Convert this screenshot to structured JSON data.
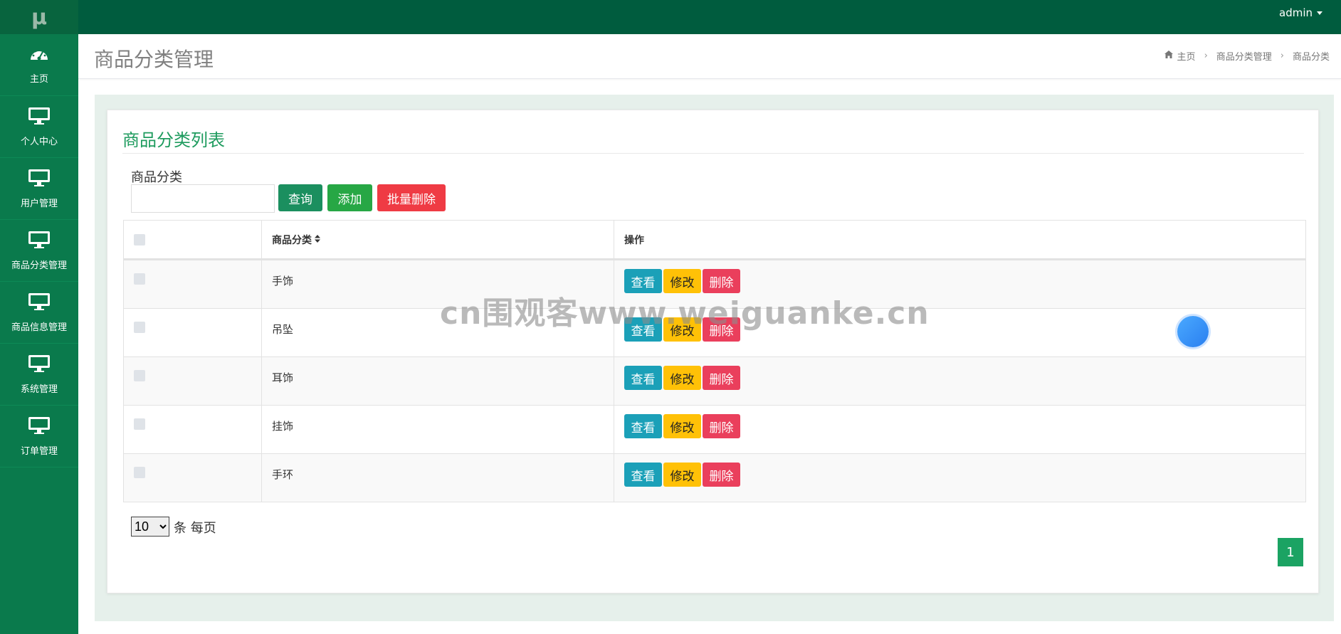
{
  "sidebar": {
    "logo": "μ",
    "items": [
      {
        "label": "主页",
        "icon": "dashboard-icon"
      },
      {
        "label": "个人中心",
        "icon": "monitor-icon"
      },
      {
        "label": "用户管理",
        "icon": "monitor-icon"
      },
      {
        "label": "商品分类管理",
        "icon": "monitor-icon"
      },
      {
        "label": "商品信息管理",
        "icon": "monitor-icon"
      },
      {
        "label": "系统管理",
        "icon": "monitor-icon"
      },
      {
        "label": "订单管理",
        "icon": "monitor-icon"
      }
    ]
  },
  "topbar": {
    "user": "admin"
  },
  "header": {
    "title": "商品分类管理",
    "breadcrumb": [
      "主页",
      "商品分类管理",
      "商品分类"
    ]
  },
  "panel": {
    "title": "商品分类列表",
    "search_label": "商品分类",
    "search_value": "",
    "buttons": {
      "query": "查询",
      "add": "添加",
      "batch_delete": "批量删除"
    }
  },
  "table": {
    "columns": [
      "商品分类",
      "操作"
    ],
    "rows": [
      {
        "category": "手饰"
      },
      {
        "category": "吊坠"
      },
      {
        "category": "耳饰"
      },
      {
        "category": "挂饰"
      },
      {
        "category": "手环"
      }
    ],
    "actions": {
      "view": "查看",
      "edit": "修改",
      "delete": "删除"
    }
  },
  "pager": {
    "per_page": "10",
    "per_page_label": "条 每页",
    "current_page": "1"
  },
  "watermark": "cn围观客www.weiguanke.cn",
  "colors": {
    "sidebar": "#0a7a4c",
    "topbar": "#005c3e",
    "accent": "#1e9b5e"
  }
}
